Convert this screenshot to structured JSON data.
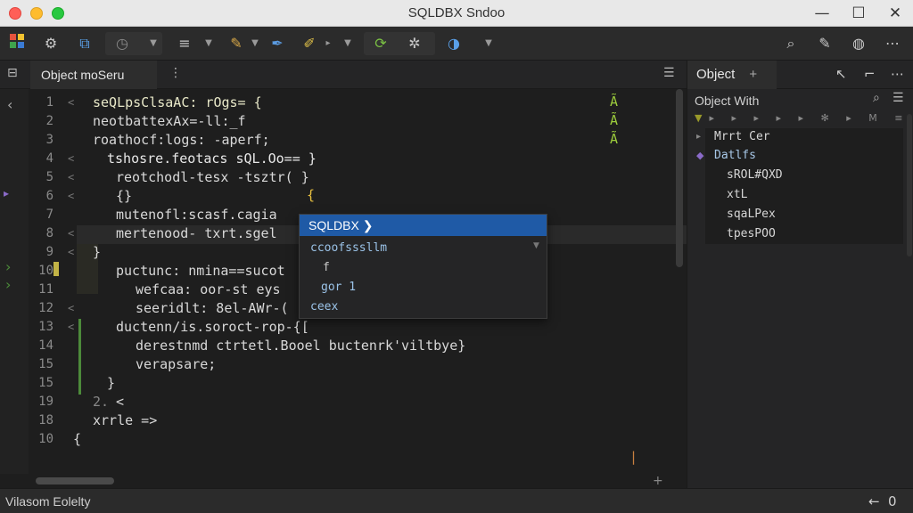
{
  "window": {
    "title": "SQLDBX Sndoo",
    "min": "—",
    "max": "☐",
    "close": "✕"
  },
  "toolbar": {
    "icons": [
      "grid-icon",
      "gear-icon",
      "export-icon",
      "clock-icon",
      "align-icon",
      "brush-icon",
      "pen-icon",
      "wand-icon",
      "refresh-icon",
      "snowflake-icon",
      "chart-icon",
      "search-icon",
      "edit-icon",
      "chat-icon",
      "more-icon"
    ]
  },
  "tabs": {
    "active_label": "Object moSeru",
    "menu_icon": "⋮"
  },
  "editor": {
    "lines": [
      {
        "num": "1",
        "code": "seQLpsClsaAC: rOgs= {"
      },
      {
        "num": "2",
        "code": "neotbattexAx=-ll:_f"
      },
      {
        "num": "3",
        "code": "roathocf:logs: -aperf;"
      },
      {
        "num": "4",
        "code": "tshosre.feotacs sQL.Oo== }"
      },
      {
        "num": "5",
        "code": "reotchodl-tesx -tsztr( }"
      },
      {
        "num": "6",
        "code": "{}"
      },
      {
        "num": "7",
        "code": "mutenofl:scasf.cagia"
      },
      {
        "num": "8",
        "code": "mertenood- txrt.sgel"
      },
      {
        "num": "9",
        "code": "}"
      },
      {
        "num": "10",
        "code": "puctunc: nmina==sucot"
      },
      {
        "num": "11",
        "code": "wefcaa: oor-st eys"
      },
      {
        "num": "12",
        "code": "seeridlt: 8el-AWr-("
      },
      {
        "num": "13",
        "code": "ductenn/is.soroct-rop-{["
      },
      {
        "num": "14",
        "code": "derestnmd ctrtetl.Booel buctenrk'viltbye}"
      },
      {
        "num": "15",
        "code": "verapsare;"
      },
      {
        "num": "15",
        "code": "}"
      },
      {
        "num": "19",
        "code": "<"
      },
      {
        "num": "18",
        "code": "xrrle =>"
      },
      {
        "num": "10",
        "code": "{"
      }
    ],
    "line_markers": [
      "<",
      "<",
      "<",
      "<",
      "<",
      "<",
      "<",
      "<",
      "<",
      "<",
      "<",
      "<",
      "<",
      "<",
      "<",
      "<",
      "2.",
      "<",
      ""
    ],
    "annotations": [
      "Ã",
      "Ã",
      "Ã"
    ],
    "warning_mark": "{",
    "end_mark": "|"
  },
  "autocomplete": {
    "header": "SQLDBX ❯",
    "items": [
      "ccoofsssllm",
      "f",
      "gor 1",
      "ceex"
    ]
  },
  "sidebar": {
    "tab_label": "Object",
    "add_label": "+",
    "header": "Object With",
    "tree": [
      "Mrrt Cer",
      "Datlfs",
      "sROL#QXD",
      "xtL",
      "sqaLPex",
      "tpesPOO"
    ]
  },
  "status": {
    "text": "Vilasom Eolelty",
    "right1": "←",
    "right2": "0"
  },
  "colors": {
    "accent": "#1f5aa6",
    "annotation": "#9ccc3c",
    "diff": "#4c8a3a"
  }
}
